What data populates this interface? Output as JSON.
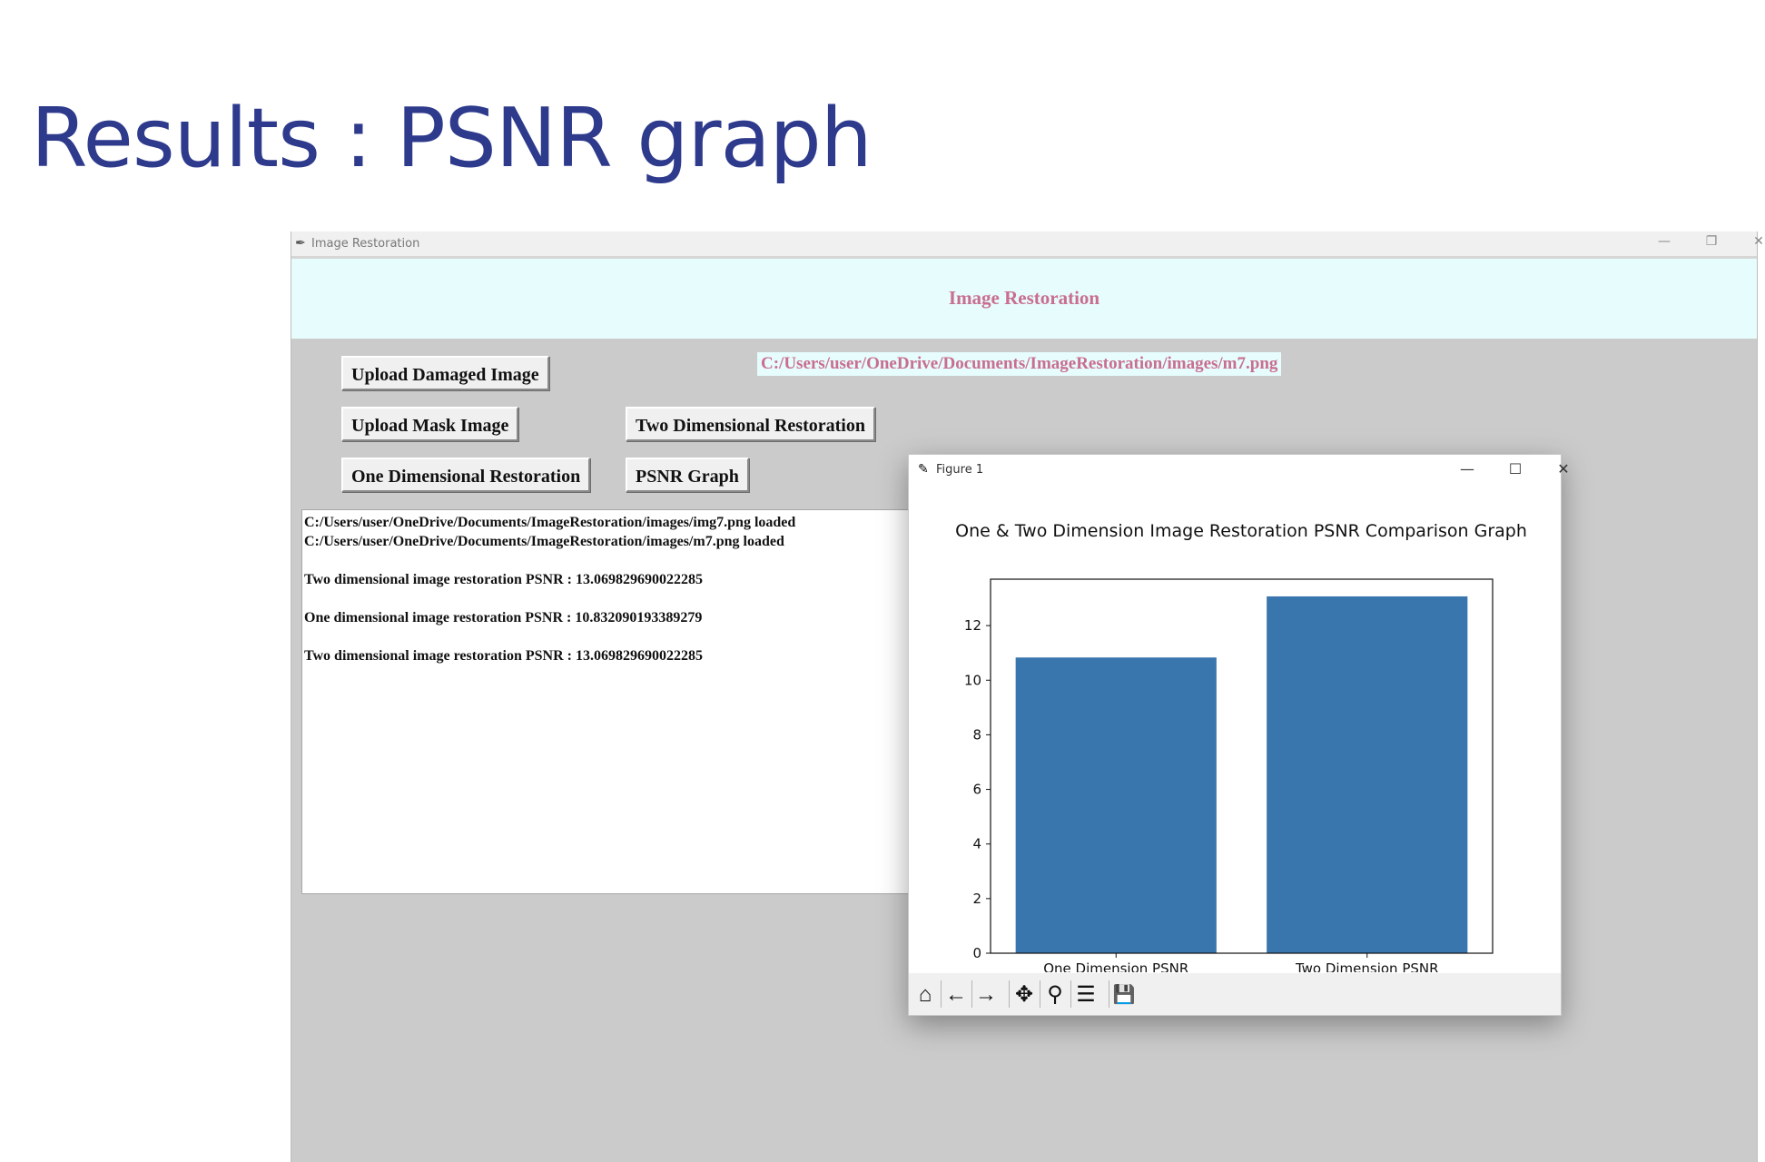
{
  "slide": {
    "title": "Results : PSNR graph"
  },
  "app": {
    "window_title": "Image Restoration",
    "heading": "Image Restoration",
    "loaded_path": "C:/Users/user/OneDrive/Documents/ImageRestoration/images/m7.png",
    "buttons": {
      "upload_damaged": "Upload Damaged Image",
      "upload_mask": "Upload Mask Image",
      "one_dim": "One Dimensional Restoration",
      "two_dim": "Two Dimensional Restoration",
      "psnr": "PSNR Graph"
    },
    "log": [
      "C:/Users/user/OneDrive/Documents/ImageRestoration/images/img7.png loaded",
      "C:/Users/user/OneDrive/Documents/ImageRestoration/images/m7.png loaded",
      "",
      "Two dimensional image restoration PSNR : 13.069829690022285",
      "",
      "One dimensional image restoration PSNR : 10.832090193389279",
      "",
      "Two dimensional image restoration PSNR : 13.069829690022285"
    ],
    "window_controls": {
      "minimize": "—",
      "restore": "❐",
      "close": "✕"
    }
  },
  "figure": {
    "window_title": "Figure 1",
    "window_controls": {
      "minimize": "—",
      "maximize": "☐",
      "close": "✕"
    },
    "toolbar": {
      "home_icon": "⌂",
      "back_icon": "←",
      "forward_icon": "→",
      "pan_icon": "✥",
      "zoom_icon": "⚲",
      "configure_icon": "☰",
      "save_icon": "💾"
    }
  },
  "chart_data": {
    "type": "bar",
    "title": "One & Two Dimension Image Restoration PSNR Comparison Graph",
    "xlabel": "",
    "ylabel": "",
    "categories": [
      "One Dimension PSNR",
      "Two Dimension PSNR"
    ],
    "values": [
      10.832090193389279,
      13.069829690022285
    ],
    "ylim": [
      0,
      13.7
    ],
    "yticks": [
      0,
      2,
      4,
      6,
      8,
      10,
      12
    ],
    "bar_color": "#3a76ae",
    "grid": false,
    "legend": false
  }
}
